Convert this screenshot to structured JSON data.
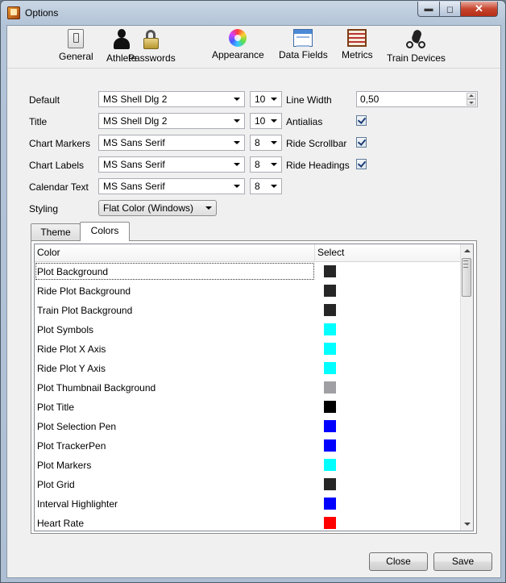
{
  "window": {
    "title": "Options"
  },
  "toolbar": {
    "items": [
      {
        "label": "General",
        "icon": "general-icon"
      },
      {
        "label": "Athlete",
        "icon": "athlete-icon"
      },
      {
        "label": "Passwords",
        "icon": "lock-icon"
      },
      {
        "label": "Appearance",
        "icon": "color-wheel-icon"
      },
      {
        "label": "Data Fields",
        "icon": "data-fields-icon"
      },
      {
        "label": "Metrics",
        "icon": "abacus-icon"
      },
      {
        "label": "Train Devices",
        "icon": "bike-icon"
      }
    ]
  },
  "fonts": {
    "default": {
      "label": "Default",
      "font": "MS Shell Dlg 2",
      "size": "10"
    },
    "title": {
      "label": "Title",
      "font": "MS Shell Dlg 2",
      "size": "10"
    },
    "chart_markers": {
      "label": "Chart Markers",
      "font": "MS Sans Serif",
      "size": "8"
    },
    "chart_labels": {
      "label": "Chart Labels",
      "font": "MS Sans Serif",
      "size": "8"
    },
    "calendar_text": {
      "label": "Calendar Text",
      "font": "MS Sans Serif",
      "size": "8"
    }
  },
  "options": {
    "line_width_label": "Line Width",
    "line_width_value": "0,50",
    "antialias_label": "Antialias",
    "antialias_checked": true,
    "ride_scrollbar_label": "Ride Scrollbar",
    "ride_scrollbar_checked": true,
    "ride_headings_label": "Ride Headings",
    "ride_headings_checked": true
  },
  "styling": {
    "label": "Styling",
    "value": "Flat Color (Windows)"
  },
  "tabs": [
    {
      "label": "Theme",
      "active": false
    },
    {
      "label": "Colors",
      "active": true
    }
  ],
  "colors_table": {
    "headers": {
      "color": "Color",
      "select": "Select"
    },
    "rows": [
      {
        "name": "Plot Background",
        "color": "#262626"
      },
      {
        "name": "Ride Plot Background",
        "color": "#262626"
      },
      {
        "name": "Train Plot Background",
        "color": "#262626"
      },
      {
        "name": "Plot Symbols",
        "color": "#00ffff"
      },
      {
        "name": "Ride Plot X Axis",
        "color": "#00ffff"
      },
      {
        "name": "Ride Plot Y Axis",
        "color": "#00ffff"
      },
      {
        "name": "Plot Thumbnail Background",
        "color": "#a0a0a4"
      },
      {
        "name": "Plot Title",
        "color": "#000000"
      },
      {
        "name": "Plot Selection Pen",
        "color": "#0000ff"
      },
      {
        "name": "Plot TrackerPen",
        "color": "#0000ff"
      },
      {
        "name": "Plot Markers",
        "color": "#00ffff"
      },
      {
        "name": "Plot Grid",
        "color": "#262626"
      },
      {
        "name": "Interval Highlighter",
        "color": "#0000ff"
      },
      {
        "name": "Heart Rate",
        "color": "#ff0000"
      }
    ]
  },
  "buttons": {
    "close": "Close",
    "save": "Save"
  }
}
